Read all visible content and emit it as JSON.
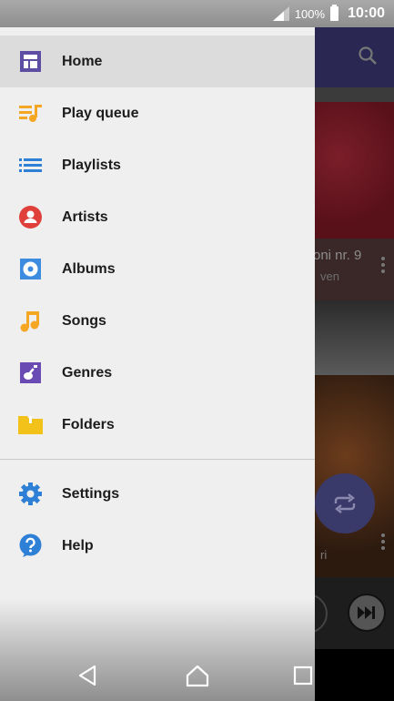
{
  "status_bar": {
    "battery_percent": "100%",
    "time": "10:00"
  },
  "background_app": {
    "track_title_fragment": "oni nr. 9",
    "track_artist_fragment": "ven",
    "second_card_subtitle_fragment": "ri"
  },
  "drawer": {
    "items": [
      {
        "label": "Home",
        "icon": "home-icon",
        "color": "#5e4ea3",
        "selected": true
      },
      {
        "label": "Play queue",
        "icon": "play-queue-icon",
        "color": "#f5a623"
      },
      {
        "label": "Playlists",
        "icon": "playlists-icon",
        "color": "#2e7fd6"
      },
      {
        "label": "Artists",
        "icon": "artists-icon",
        "color": "#e0403a"
      },
      {
        "label": "Albums",
        "icon": "albums-icon",
        "color": "#3d8ce0"
      },
      {
        "label": "Songs",
        "icon": "songs-icon",
        "color": "#f5a623"
      },
      {
        "label": "Genres",
        "icon": "genres-icon",
        "color": "#6a4ab3"
      },
      {
        "label": "Folders",
        "icon": "folders-icon",
        "color": "#f2c21b"
      }
    ],
    "secondary_items": [
      {
        "label": "Settings",
        "icon": "gear-icon",
        "color": "#2e7fd6"
      },
      {
        "label": "Help",
        "icon": "help-icon",
        "color": "#2e7fd6"
      }
    ]
  },
  "navigation_bar": {
    "buttons": [
      "back-icon",
      "home-nav-icon",
      "recents-icon"
    ]
  }
}
